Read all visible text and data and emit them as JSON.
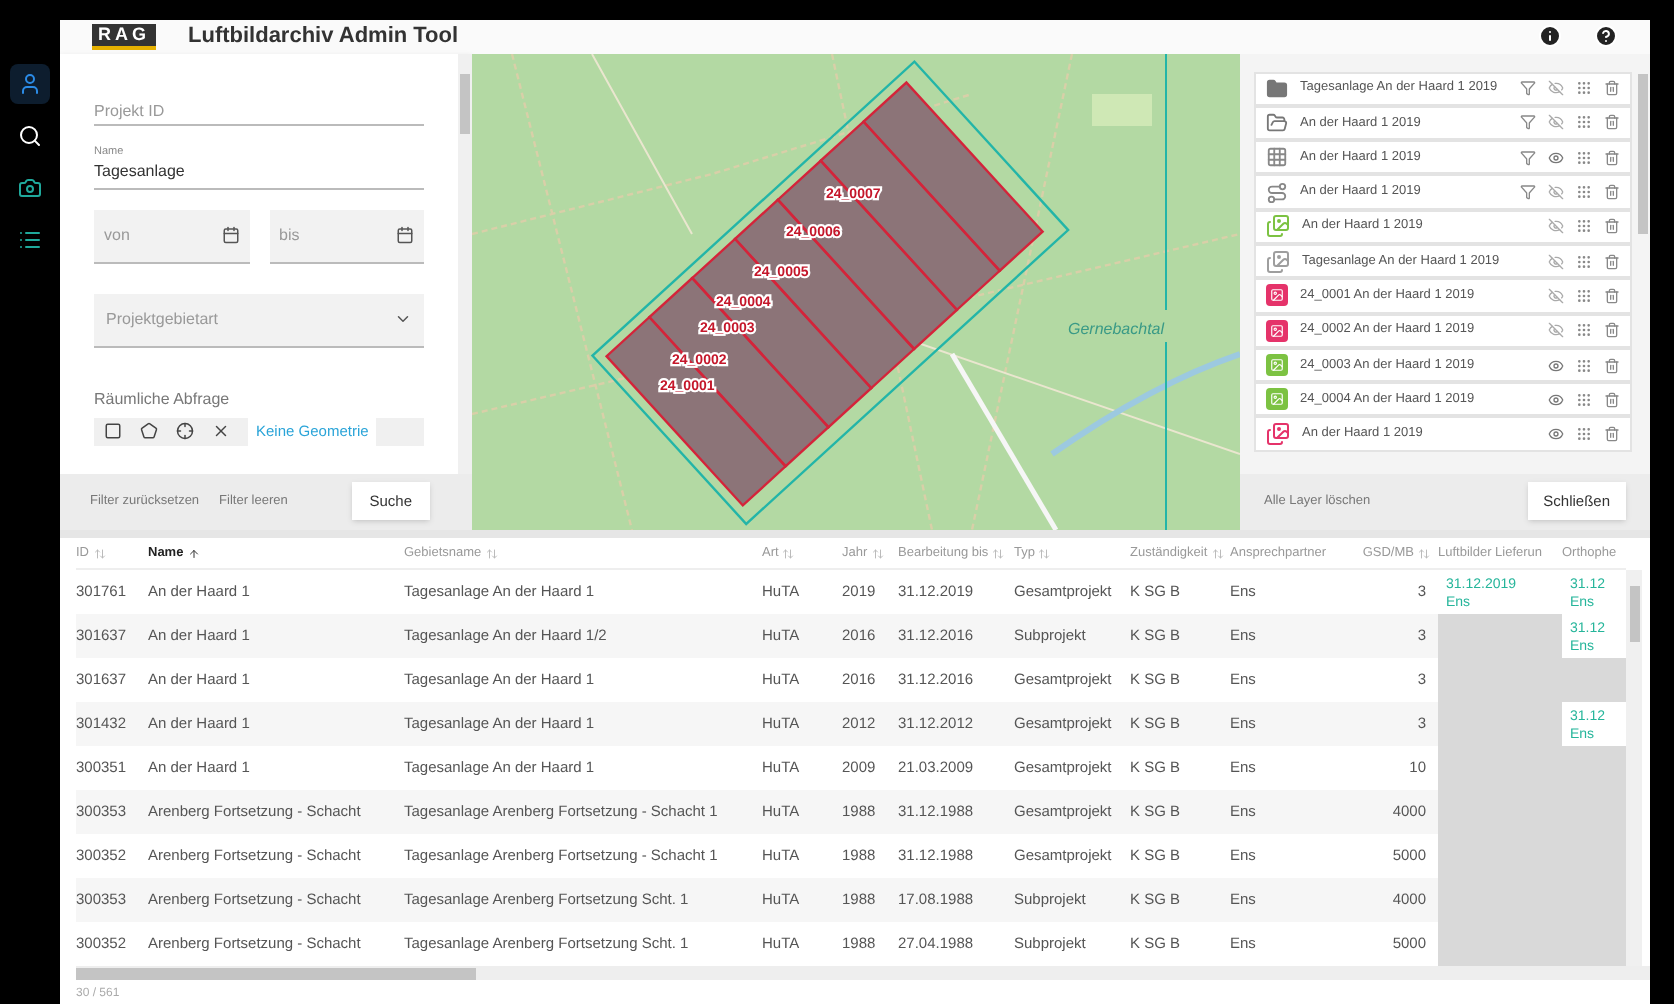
{
  "app": {
    "logo": "RAG",
    "title": "Luftbildarchiv Admin Tool"
  },
  "nav": [
    {
      "kind": "user",
      "selected": true
    },
    {
      "kind": "search",
      "selected": false
    },
    {
      "kind": "camera",
      "selected": false
    },
    {
      "kind": "list",
      "selected": false
    }
  ],
  "filter": {
    "project_id": {
      "placeholder": "Projekt ID"
    },
    "name": {
      "label": "Name",
      "value": "Tagesanlage"
    },
    "from": {
      "placeholder": "von"
    },
    "to": {
      "placeholder": "bis"
    },
    "area_type": {
      "placeholder": "Projektgebietart"
    },
    "spatial_label": "Räumliche Abfrage",
    "no_geometry": "Keine Geometrie",
    "reset": "Filter zurücksetzen",
    "clear": "Filter leeren",
    "search": "Suche"
  },
  "map": {
    "tiles": [
      "24_0007",
      "24_0006",
      "24_0005",
      "24_0004",
      "24_0003",
      "24_0002",
      "24_0001"
    ],
    "place_label": "Gernebachtal"
  },
  "layers": {
    "items": [
      {
        "kind": "folder",
        "label": "Tagesanlage An der Haard 1 2019",
        "filter": true,
        "visible": false
      },
      {
        "kind": "folder-outline",
        "label": "An der Haard 1 2019",
        "filter": true,
        "visible": false
      },
      {
        "kind": "grid",
        "label": "An der Haard 1 2019",
        "filter": true,
        "visible": true
      },
      {
        "kind": "route",
        "label": "An der Haard 1 2019",
        "filter": true,
        "visible": false
      },
      {
        "kind": "image-stack",
        "color": "#7cc242",
        "label": "An der Haard 1 2019",
        "filter": false,
        "visible": false
      },
      {
        "kind": "image-stack",
        "color": "#9e9e9e",
        "label": "Tagesanlage An der Haard 1 2019",
        "filter": false,
        "visible": false
      },
      {
        "kind": "image",
        "color": "#e5336a",
        "label": "24_0001 An der Haard 1 2019",
        "filter": false,
        "visible": false
      },
      {
        "kind": "image",
        "color": "#e5336a",
        "label": "24_0002 An der Haard 1 2019",
        "filter": false,
        "visible": false
      },
      {
        "kind": "image",
        "color": "#7cc242",
        "label": "24_0003 An der Haard 1 2019",
        "filter": false,
        "visible": true
      },
      {
        "kind": "image",
        "color": "#7cc242",
        "label": "24_0004 An der Haard 1 2019",
        "filter": false,
        "visible": true
      },
      {
        "kind": "image-stack",
        "color": "#e5336a",
        "label": "An der Haard 1 2019",
        "filter": false,
        "visible": true
      }
    ],
    "delete_all": "Alle Layer löschen",
    "close": "Schließen"
  },
  "table": {
    "columns": [
      {
        "label": "ID",
        "sortable": true,
        "sorted": false
      },
      {
        "label": "Name",
        "sortable": true,
        "sorted": true
      },
      {
        "label": "Gebietsname",
        "sortable": true,
        "sorted": false
      },
      {
        "label": "Art",
        "sortable": true,
        "sorted": false
      },
      {
        "label": "Jahr",
        "sortable": true,
        "sorted": false
      },
      {
        "label": "Bearbeitung bis",
        "sortable": true,
        "sorted": false
      },
      {
        "label": "Typ",
        "sortable": true,
        "sorted": false
      },
      {
        "label": "Zuständigkeit",
        "sortable": true,
        "sorted": false
      },
      {
        "label": "Ansprechpartner"
      },
      {
        "label": "GSD/MB",
        "sortable": true,
        "sorted": false
      },
      {
        "label": "Luftbilder Lieferun"
      },
      {
        "label": "Orthophe"
      }
    ],
    "rows": [
      {
        "cells": [
          "301761",
          "An der Haard 1",
          "Tagesanlage An der Haard 1",
          "HuTA",
          "2019",
          "31.12.2019",
          "Gesamtprojekt",
          "K SG B",
          "Ens",
          "3"
        ],
        "delivery": {
          "date": "31.12.2019",
          "person": "Ens"
        },
        "ortho": {
          "date": "31.12",
          "person": "Ens"
        }
      },
      {
        "cells": [
          "301637",
          "An der Haard 1",
          "Tagesanlage An der Haard 1/2",
          "HuTA",
          "2016",
          "31.12.2016",
          "Subprojekt",
          "K SG B",
          "Ens",
          "3"
        ],
        "delivery": null,
        "ortho": {
          "date": "31.12",
          "person": "Ens"
        }
      },
      {
        "cells": [
          "301637",
          "An der Haard 1",
          "Tagesanlage An der Haard 1",
          "HuTA",
          "2016",
          "31.12.2016",
          "Gesamtprojekt",
          "K SG B",
          "Ens",
          "3"
        ],
        "delivery": null,
        "ortho": null
      },
      {
        "cells": [
          "301432",
          "An der Haard 1",
          "Tagesanlage An der Haard 1",
          "HuTA",
          "2012",
          "31.12.2012",
          "Gesamtprojekt",
          "K SG B",
          "Ens",
          "3"
        ],
        "delivery": null,
        "ortho": {
          "date": "31.12",
          "person": "Ens"
        }
      },
      {
        "cells": [
          "300351",
          "An der Haard 1",
          "Tagesanlage An der Haard 1",
          "HuTA",
          "2009",
          "21.03.2009",
          "Gesamtprojekt",
          "K SG B",
          "Ens",
          "10"
        ],
        "delivery": null,
        "ortho": null
      },
      {
        "cells": [
          "300353",
          "Arenberg Fortsetzung - Schacht",
          "Tagesanlage Arenberg Fortsetzung - Schacht 1",
          "HuTA",
          "1988",
          "31.12.1988",
          "Gesamtprojekt",
          "K SG B",
          "Ens",
          "4000"
        ],
        "delivery": null,
        "ortho": null
      },
      {
        "cells": [
          "300352",
          "Arenberg Fortsetzung - Schacht",
          "Tagesanlage Arenberg Fortsetzung - Schacht 1",
          "HuTA",
          "1988",
          "31.12.1988",
          "Gesamtprojekt",
          "K SG B",
          "Ens",
          "5000"
        ],
        "delivery": null,
        "ortho": null
      },
      {
        "cells": [
          "300353",
          "Arenberg Fortsetzung - Schacht",
          "Tagesanlage Arenberg Fortsetzung Scht. 1",
          "HuTA",
          "1988",
          "17.08.1988",
          "Subprojekt",
          "K SG B",
          "Ens",
          "4000"
        ],
        "delivery": null,
        "ortho": null
      },
      {
        "cells": [
          "300352",
          "Arenberg Fortsetzung - Schacht",
          "Tagesanlage Arenberg Fortsetzung Scht. 1",
          "HuTA",
          "1988",
          "27.04.1988",
          "Subprojekt",
          "K SG B",
          "Ens",
          "5000"
        ],
        "delivery": null,
        "ortho": null
      }
    ],
    "count": "30 / 561"
  }
}
